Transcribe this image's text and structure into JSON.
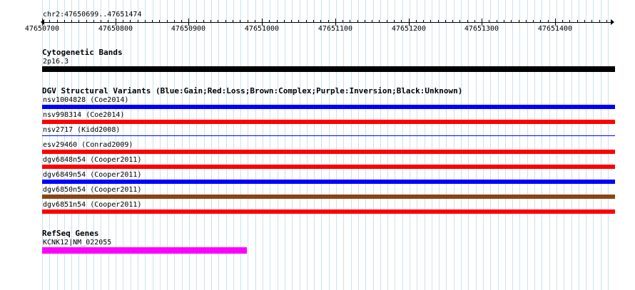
{
  "location": "chr2:47650699..47651474",
  "ruler": {
    "ticks": [
      "47650700",
      "47650800",
      "47650900",
      "47651000",
      "47651100",
      "47651200",
      "47651300",
      "47651400"
    ]
  },
  "cytoband": {
    "title": "Cytogenetic Bands",
    "band": "2p16.3",
    "color": "#000000"
  },
  "dgv": {
    "title": "DGV Structural Variants (Blue:Gain;Red:Loss;Brown:Complex;Purple:Inversion;Black:Unknown)",
    "colors": {
      "gain": "#0000ff",
      "loss": "#ff0000",
      "complex": "#8b4513"
    },
    "variants": [
      {
        "label": "nsv1004828 (Coe2014)",
        "color": "#0000ff"
      },
      {
        "label": "nsv998314 (Coe2014)",
        "color": "#ff0000"
      },
      {
        "label": "nsv2717 (Kidd2008)",
        "color": "#0000ff"
      },
      {
        "label": "esv29460 (Conrad2009)",
        "color": "#ff0000"
      },
      {
        "label": "dgv6848n54 (Cooper2011)",
        "color": "#ff0000"
      },
      {
        "label": "dgv6849n54 (Cooper2011)",
        "color": "#0000ff"
      },
      {
        "label": "dgv6850n54 (Cooper2011)",
        "color": "#8b4513"
      },
      {
        "label": "dgv6851n54 (Cooper2011)",
        "color": "#ff0000"
      }
    ]
  },
  "refseq": {
    "title": "RefSeq Genes",
    "gene": "KCNK12|NM_022055",
    "color": "#ff00ff"
  }
}
